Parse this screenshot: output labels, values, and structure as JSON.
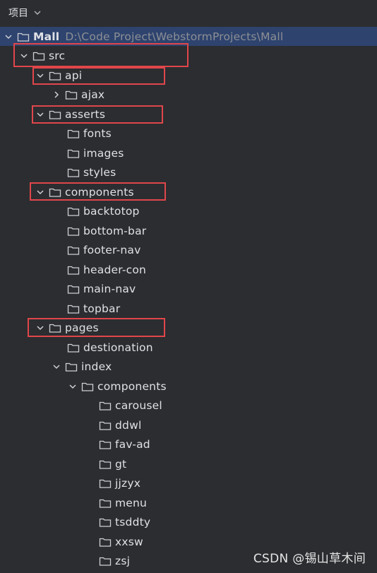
{
  "header": {
    "title": "项目"
  },
  "root": {
    "name": "Mall",
    "path": "D:\\Code Project\\WebstormProjects\\Mall"
  },
  "tree": {
    "src": "src",
    "api": "api",
    "ajax": "ajax",
    "asserts": "asserts",
    "fonts": "fonts",
    "images": "images",
    "styles": "styles",
    "components": "components",
    "backtotop": "backtotop",
    "bottom_bar": "bottom-bar",
    "footer_nav": "footer-nav",
    "header_con": "header-con",
    "main_nav": "main-nav",
    "topbar": "topbar",
    "pages": "pages",
    "destionation": "destionation",
    "index": "index",
    "index_components": "components",
    "carousel": "carousel",
    "ddwl": "ddwl",
    "fav_ad": "fav-ad",
    "gt": "gt",
    "jjzyx": "jjzyx",
    "menu": "menu",
    "tsddty": "tsddty",
    "xxsw": "xxsw",
    "zsj": "zsj"
  },
  "icons": {
    "expanded": "chevron-down-icon",
    "collapsed": "chevron-right-icon",
    "folder": "folder-icon"
  },
  "colors": {
    "background": "#2b2d30",
    "selection": "#2e436e",
    "text": "#dfe1e5",
    "path_text": "#8c8f94",
    "highlight_box": "#e0464b"
  },
  "watermark": "CSDN @锡山草木间"
}
